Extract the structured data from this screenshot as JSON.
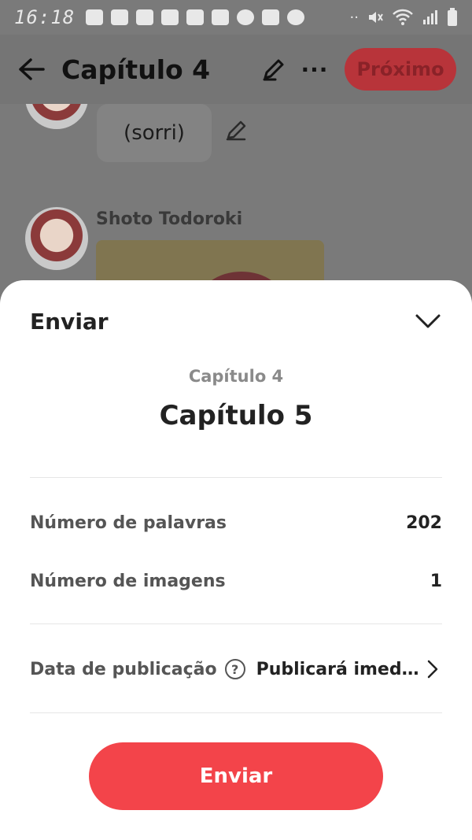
{
  "status_bar": {
    "time": "16:18"
  },
  "top_bar": {
    "title": "Capítulo 4",
    "next_label": "Próximo"
  },
  "chat": {
    "bubble_text": "(sorri)",
    "sender_name": "Shoto Todoroki"
  },
  "sheet": {
    "title": "Enviar",
    "previous_chapter": "Capítulo 4",
    "new_chapter": "Capítulo 5",
    "word_count_label": "Número de palavras",
    "word_count_value": "202",
    "image_count_label": "Número de imagens",
    "image_count_value": "1",
    "publish_date_label": "Data de publicação",
    "publish_date_value": "Publicará imedi...",
    "send_label": "Enviar"
  },
  "colors": {
    "accent": "#f3444a",
    "overlay_accent": "#b8343a"
  }
}
